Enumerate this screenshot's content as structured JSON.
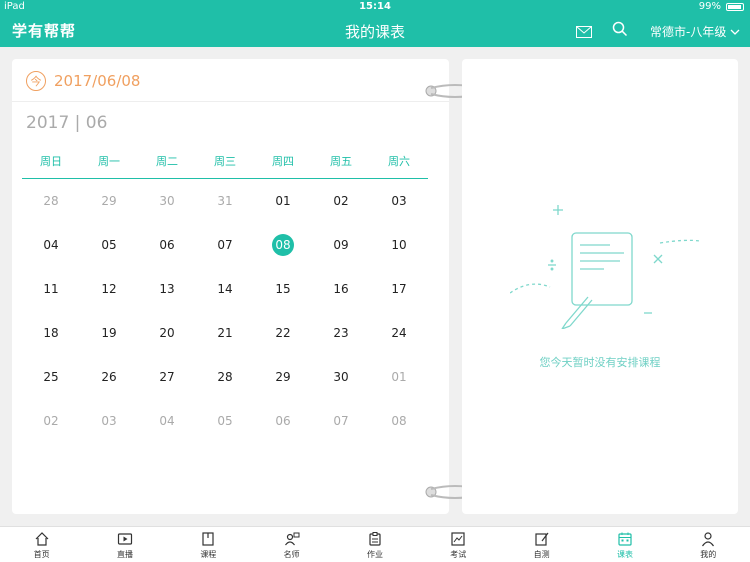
{
  "status": {
    "device": "iPad",
    "time": "15:14",
    "battery": "99%"
  },
  "nav": {
    "brand": "学有帮帮",
    "title": "我的课表",
    "region": "常德市-八年级"
  },
  "calendar": {
    "today_badge": "今",
    "today_date": "2017/06/08",
    "month": "2017 | 06",
    "weekdays": [
      "周日",
      "周一",
      "周二",
      "周三",
      "周四",
      "周五",
      "周六"
    ],
    "weeks": [
      [
        "28",
        "29",
        "30",
        "31",
        "01",
        "02",
        "03"
      ],
      [
        "04",
        "05",
        "06",
        "07",
        "08",
        "09",
        "10"
      ],
      [
        "11",
        "12",
        "13",
        "14",
        "15",
        "16",
        "17"
      ],
      [
        "18",
        "19",
        "20",
        "21",
        "22",
        "23",
        "24"
      ],
      [
        "25",
        "26",
        "27",
        "28",
        "29",
        "30",
        "01"
      ],
      [
        "02",
        "03",
        "04",
        "05",
        "06",
        "07",
        "08"
      ]
    ],
    "selected": "08"
  },
  "empty": {
    "text": "您今天暂时没有安排课程"
  },
  "tabs": [
    {
      "label": "首页",
      "icon": "home-icon"
    },
    {
      "label": "直播",
      "icon": "live-icon"
    },
    {
      "label": "课程",
      "icon": "course-icon"
    },
    {
      "label": "名师",
      "icon": "teacher-icon"
    },
    {
      "label": "作业",
      "icon": "homework-icon"
    },
    {
      "label": "考试",
      "icon": "exam-icon"
    },
    {
      "label": "自测",
      "icon": "selftest-icon"
    },
    {
      "label": "课表",
      "icon": "schedule-icon"
    },
    {
      "label": "我的",
      "icon": "profile-icon"
    }
  ],
  "active_tab": "课表",
  "colors": {
    "accent": "#1fbfa8",
    "today": "#f0a060",
    "dim": "#aaaaaa"
  }
}
